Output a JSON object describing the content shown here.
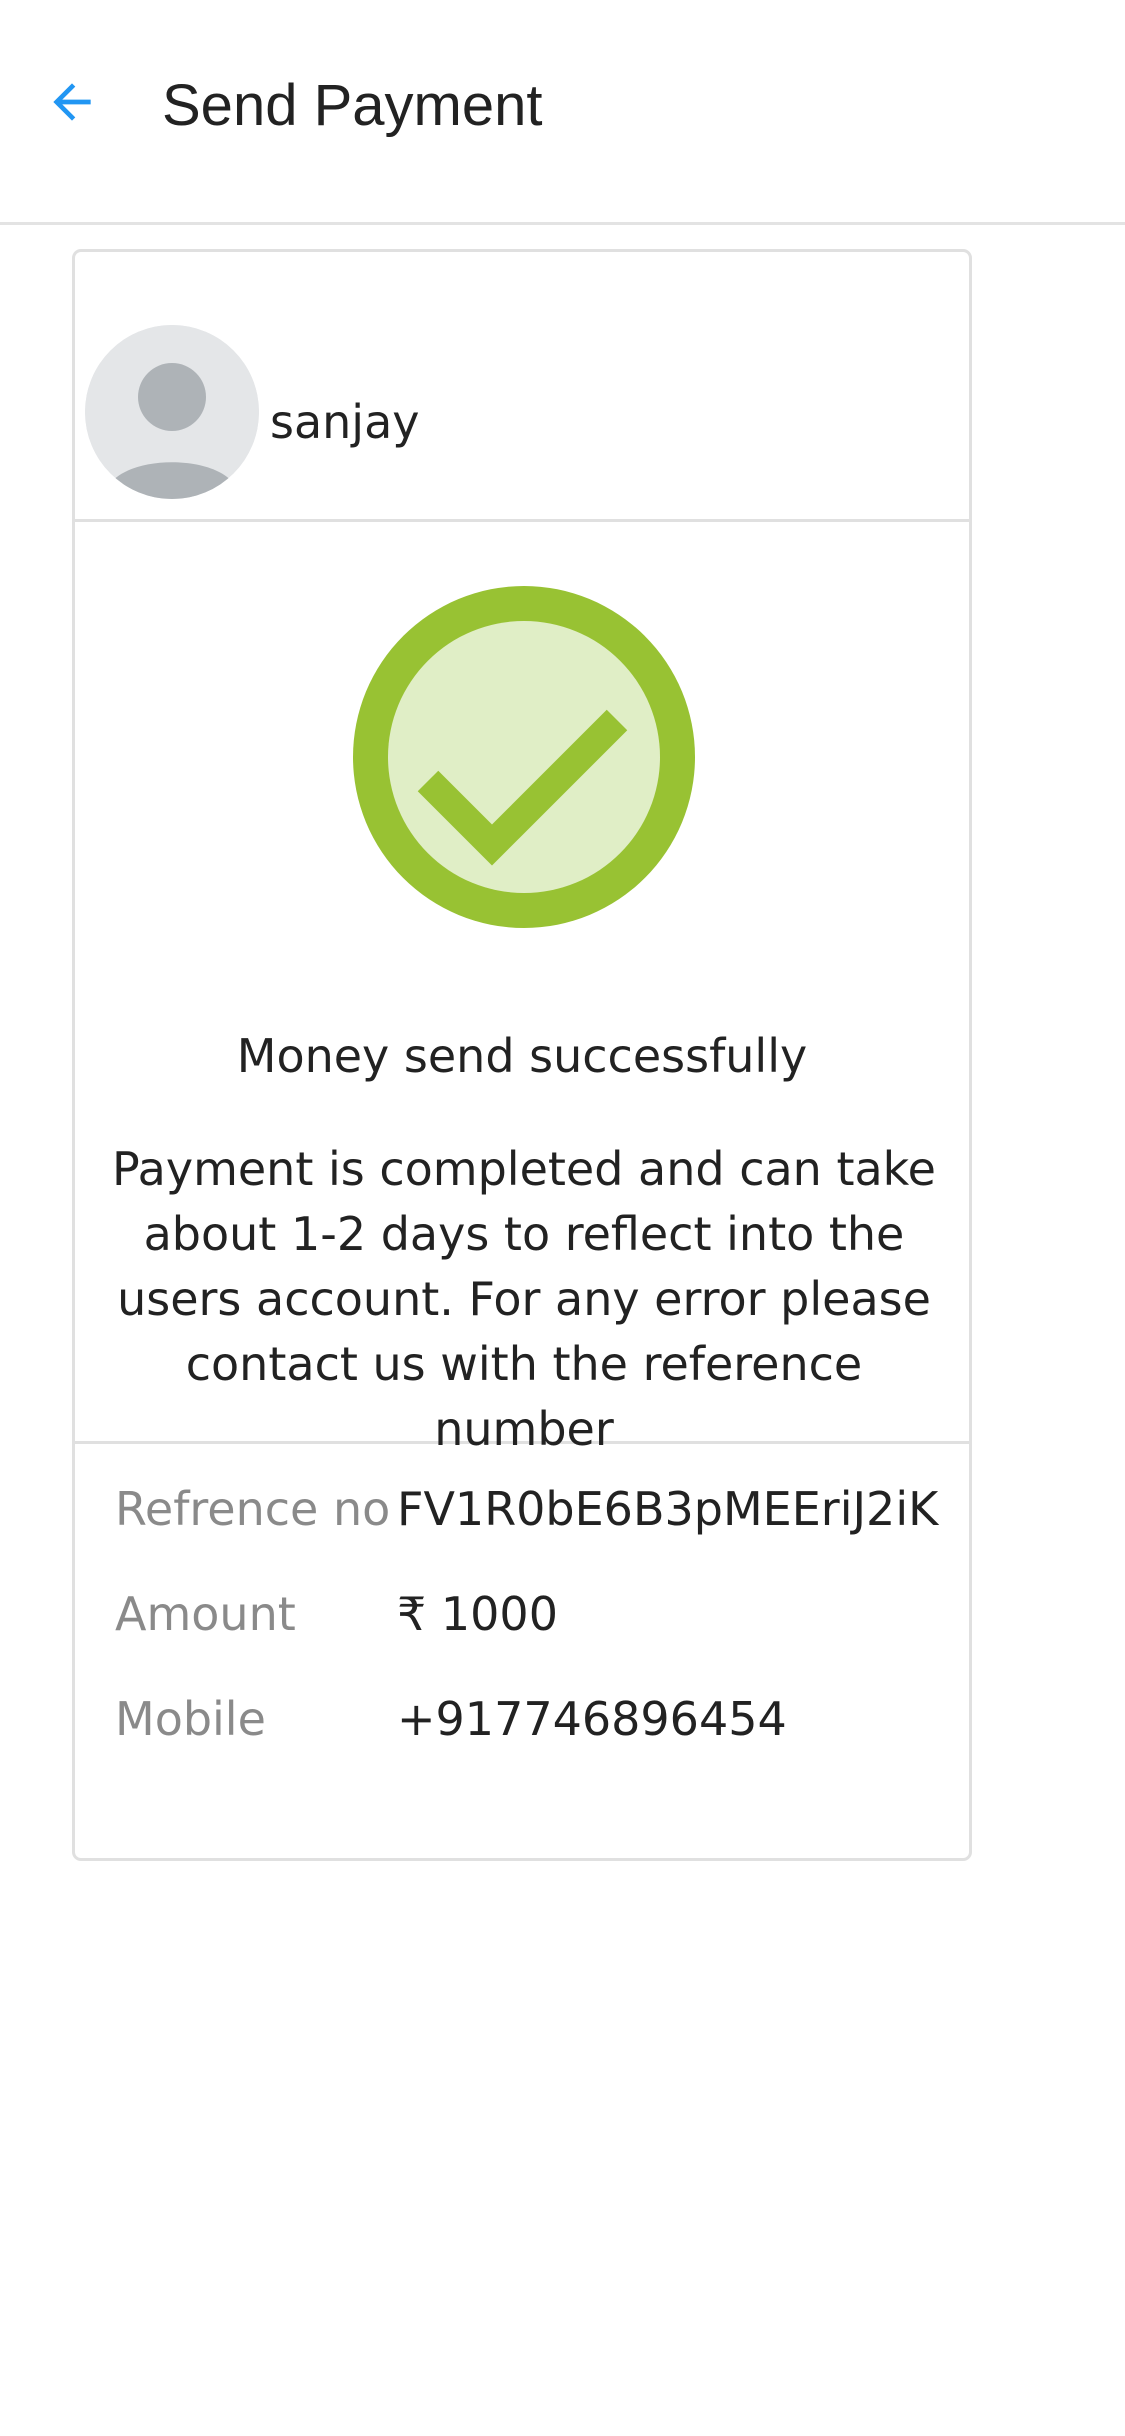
{
  "app_bar": {
    "title": "Send Payment",
    "back_icon": "arrow-left-icon",
    "accent_color": "#2196f3"
  },
  "recipient": {
    "name": "sanjay",
    "avatar_icon": "user-avatar-icon"
  },
  "status": {
    "icon": "check-circle-icon",
    "color": "#98c233",
    "title": "Money send successfully",
    "message": "Payment is completed and can take about 1-2 days to reflect into the users account. For any error please contact us with the reference number"
  },
  "details": [
    {
      "label": "Refrence no",
      "value": "FV1R0bE6B3pMEEriJ2iK"
    },
    {
      "label": "Amount",
      "value": "₹ 1000"
    },
    {
      "label": "Mobile",
      "value": "+917746896454"
    }
  ]
}
